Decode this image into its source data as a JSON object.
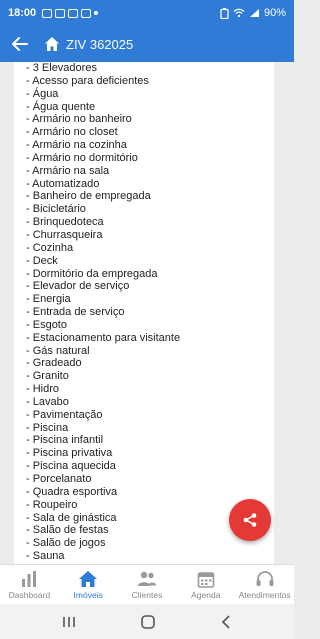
{
  "status": {
    "time": "18:00",
    "battery": "90%"
  },
  "header": {
    "title": "ZIV 362025"
  },
  "features": [
    "3 Elevadores",
    "Acesso para deficientes",
    "Água",
    "Água quente",
    "Armário no banheiro",
    "Armário no closet",
    "Armário na cozinha",
    "Armário no dormitório",
    "Armário na sala",
    "Automatizado",
    "Banheiro de empregada",
    "Bicicletário",
    "Brinquedoteca",
    "Churrasqueira",
    "Cozinha",
    "Deck",
    "Dormitório da empregada",
    "Elevador de serviço",
    "Energia",
    "Entrada de serviço",
    "Esgoto",
    "Estacionamento para visitante",
    "Gás natural",
    "Gradeado",
    "Granito",
    "Hidro",
    "Lavabo",
    "Pavimentação",
    "Piscina",
    "Piscina infantil",
    "Piscina privativa",
    "Piscina aquecida",
    "Porcelanato",
    "Quadra esportiva",
    "Roupeiro",
    "Sala de ginástica",
    "Salão de festas",
    "Salão de jogos",
    "Sauna"
  ],
  "nav": [
    {
      "label": "Dashboard",
      "icon": "bar-chart-icon",
      "active": false
    },
    {
      "label": "Imóveis",
      "icon": "house-icon",
      "active": true
    },
    {
      "label": "Clientes",
      "icon": "people-icon",
      "active": false
    },
    {
      "label": "Agenda",
      "icon": "calendar-icon",
      "active": false
    },
    {
      "label": "Atendimentos",
      "icon": "headset-icon",
      "active": false
    }
  ],
  "colors": {
    "primary": "#2f7bd6",
    "fab": "#e53935",
    "inactive": "#999999"
  }
}
